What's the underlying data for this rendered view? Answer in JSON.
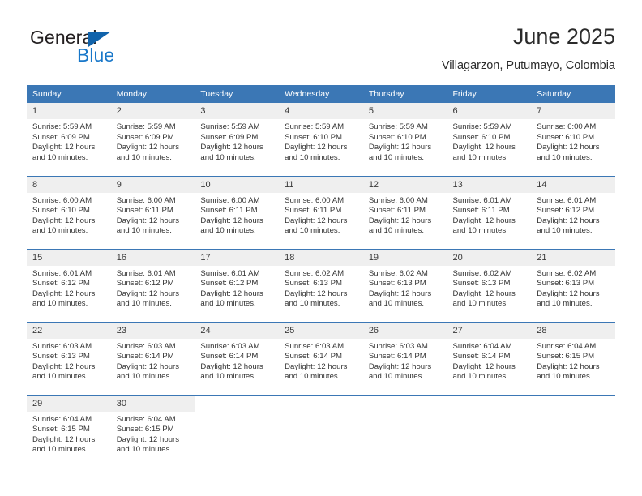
{
  "brand": {
    "name_part1": "General",
    "name_part2": "Blue",
    "triangle_color": "#1163ab",
    "blue_color": "#1877c9"
  },
  "header": {
    "title": "June 2025",
    "subtitle": "Villagarzon, Putumayo, Colombia"
  },
  "theme": {
    "header_blue": "#3b77b5",
    "daynum_band": "#efefef",
    "text": "#333333"
  },
  "weekday_headers": [
    "Sunday",
    "Monday",
    "Tuesday",
    "Wednesday",
    "Thursday",
    "Friday",
    "Saturday"
  ],
  "weeks": [
    [
      {
        "day": "1",
        "sunrise": "Sunrise: 5:59 AM",
        "sunset": "Sunset: 6:09 PM",
        "daylight": "Daylight: 12 hours and 10 minutes."
      },
      {
        "day": "2",
        "sunrise": "Sunrise: 5:59 AM",
        "sunset": "Sunset: 6:09 PM",
        "daylight": "Daylight: 12 hours and 10 minutes."
      },
      {
        "day": "3",
        "sunrise": "Sunrise: 5:59 AM",
        "sunset": "Sunset: 6:09 PM",
        "daylight": "Daylight: 12 hours and 10 minutes."
      },
      {
        "day": "4",
        "sunrise": "Sunrise: 5:59 AM",
        "sunset": "Sunset: 6:10 PM",
        "daylight": "Daylight: 12 hours and 10 minutes."
      },
      {
        "day": "5",
        "sunrise": "Sunrise: 5:59 AM",
        "sunset": "Sunset: 6:10 PM",
        "daylight": "Daylight: 12 hours and 10 minutes."
      },
      {
        "day": "6",
        "sunrise": "Sunrise: 5:59 AM",
        "sunset": "Sunset: 6:10 PM",
        "daylight": "Daylight: 12 hours and 10 minutes."
      },
      {
        "day": "7",
        "sunrise": "Sunrise: 6:00 AM",
        "sunset": "Sunset: 6:10 PM",
        "daylight": "Daylight: 12 hours and 10 minutes."
      }
    ],
    [
      {
        "day": "8",
        "sunrise": "Sunrise: 6:00 AM",
        "sunset": "Sunset: 6:10 PM",
        "daylight": "Daylight: 12 hours and 10 minutes."
      },
      {
        "day": "9",
        "sunrise": "Sunrise: 6:00 AM",
        "sunset": "Sunset: 6:11 PM",
        "daylight": "Daylight: 12 hours and 10 minutes."
      },
      {
        "day": "10",
        "sunrise": "Sunrise: 6:00 AM",
        "sunset": "Sunset: 6:11 PM",
        "daylight": "Daylight: 12 hours and 10 minutes."
      },
      {
        "day": "11",
        "sunrise": "Sunrise: 6:00 AM",
        "sunset": "Sunset: 6:11 PM",
        "daylight": "Daylight: 12 hours and 10 minutes."
      },
      {
        "day": "12",
        "sunrise": "Sunrise: 6:00 AM",
        "sunset": "Sunset: 6:11 PM",
        "daylight": "Daylight: 12 hours and 10 minutes."
      },
      {
        "day": "13",
        "sunrise": "Sunrise: 6:01 AM",
        "sunset": "Sunset: 6:11 PM",
        "daylight": "Daylight: 12 hours and 10 minutes."
      },
      {
        "day": "14",
        "sunrise": "Sunrise: 6:01 AM",
        "sunset": "Sunset: 6:12 PM",
        "daylight": "Daylight: 12 hours and 10 minutes."
      }
    ],
    [
      {
        "day": "15",
        "sunrise": "Sunrise: 6:01 AM",
        "sunset": "Sunset: 6:12 PM",
        "daylight": "Daylight: 12 hours and 10 minutes."
      },
      {
        "day": "16",
        "sunrise": "Sunrise: 6:01 AM",
        "sunset": "Sunset: 6:12 PM",
        "daylight": "Daylight: 12 hours and 10 minutes."
      },
      {
        "day": "17",
        "sunrise": "Sunrise: 6:01 AM",
        "sunset": "Sunset: 6:12 PM",
        "daylight": "Daylight: 12 hours and 10 minutes."
      },
      {
        "day": "18",
        "sunrise": "Sunrise: 6:02 AM",
        "sunset": "Sunset: 6:13 PM",
        "daylight": "Daylight: 12 hours and 10 minutes."
      },
      {
        "day": "19",
        "sunrise": "Sunrise: 6:02 AM",
        "sunset": "Sunset: 6:13 PM",
        "daylight": "Daylight: 12 hours and 10 minutes."
      },
      {
        "day": "20",
        "sunrise": "Sunrise: 6:02 AM",
        "sunset": "Sunset: 6:13 PM",
        "daylight": "Daylight: 12 hours and 10 minutes."
      },
      {
        "day": "21",
        "sunrise": "Sunrise: 6:02 AM",
        "sunset": "Sunset: 6:13 PM",
        "daylight": "Daylight: 12 hours and 10 minutes."
      }
    ],
    [
      {
        "day": "22",
        "sunrise": "Sunrise: 6:03 AM",
        "sunset": "Sunset: 6:13 PM",
        "daylight": "Daylight: 12 hours and 10 minutes."
      },
      {
        "day": "23",
        "sunrise": "Sunrise: 6:03 AM",
        "sunset": "Sunset: 6:14 PM",
        "daylight": "Daylight: 12 hours and 10 minutes."
      },
      {
        "day": "24",
        "sunrise": "Sunrise: 6:03 AM",
        "sunset": "Sunset: 6:14 PM",
        "daylight": "Daylight: 12 hours and 10 minutes."
      },
      {
        "day": "25",
        "sunrise": "Sunrise: 6:03 AM",
        "sunset": "Sunset: 6:14 PM",
        "daylight": "Daylight: 12 hours and 10 minutes."
      },
      {
        "day": "26",
        "sunrise": "Sunrise: 6:03 AM",
        "sunset": "Sunset: 6:14 PM",
        "daylight": "Daylight: 12 hours and 10 minutes."
      },
      {
        "day": "27",
        "sunrise": "Sunrise: 6:04 AM",
        "sunset": "Sunset: 6:14 PM",
        "daylight": "Daylight: 12 hours and 10 minutes."
      },
      {
        "day": "28",
        "sunrise": "Sunrise: 6:04 AM",
        "sunset": "Sunset: 6:15 PM",
        "daylight": "Daylight: 12 hours and 10 minutes."
      }
    ],
    [
      {
        "day": "29",
        "sunrise": "Sunrise: 6:04 AM",
        "sunset": "Sunset: 6:15 PM",
        "daylight": "Daylight: 12 hours and 10 minutes."
      },
      {
        "day": "30",
        "sunrise": "Sunrise: 6:04 AM",
        "sunset": "Sunset: 6:15 PM",
        "daylight": "Daylight: 12 hours and 10 minutes."
      },
      {
        "day": "",
        "sunrise": "",
        "sunset": "",
        "daylight": ""
      },
      {
        "day": "",
        "sunrise": "",
        "sunset": "",
        "daylight": ""
      },
      {
        "day": "",
        "sunrise": "",
        "sunset": "",
        "daylight": ""
      },
      {
        "day": "",
        "sunrise": "",
        "sunset": "",
        "daylight": ""
      },
      {
        "day": "",
        "sunrise": "",
        "sunset": "",
        "daylight": ""
      }
    ]
  ]
}
